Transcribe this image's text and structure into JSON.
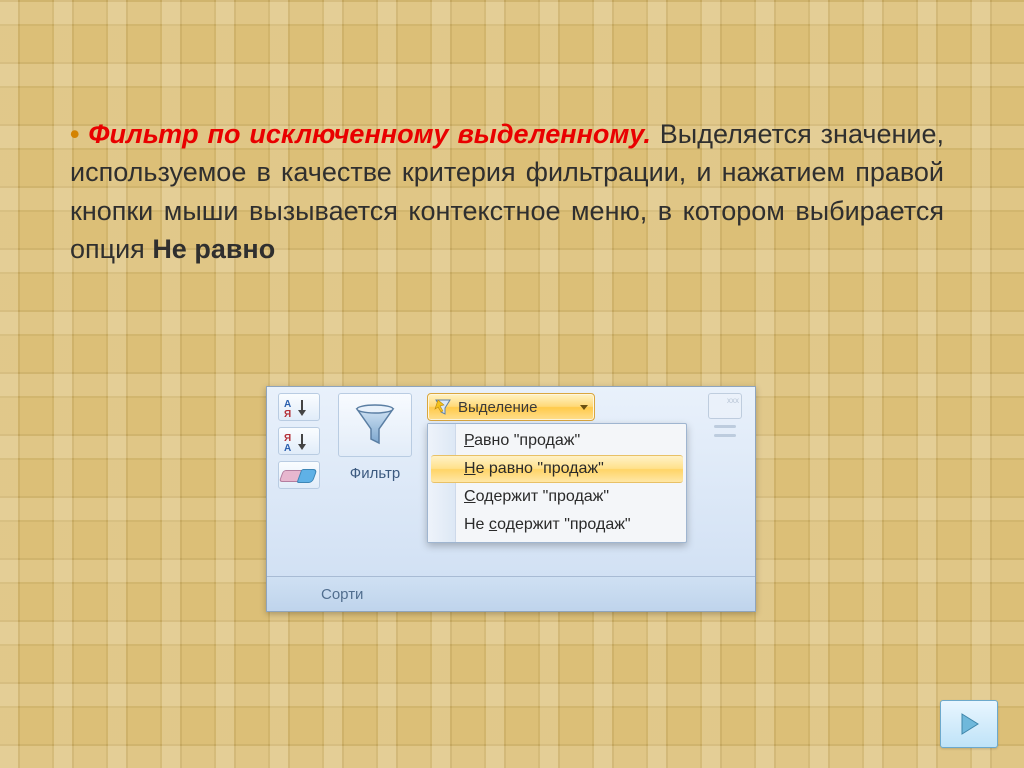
{
  "paragraph": {
    "bullet": "•",
    "title": "Фильтр по исключенному выделенному.",
    "body_a": " Выделяется значение, используемое в качестве критерия фильтрации, и нажатием правой кнопки мыши вызывается контекстное меню, в котором выбирается опция ",
    "strong_option": "Не равно"
  },
  "ribbon": {
    "filter_label": "Фильтр",
    "footer_label": "Сорти",
    "selection_label": "Выделение",
    "menu": {
      "equals": {
        "hot": "Р",
        "rest": "авно \"продаж\""
      },
      "not_equals": {
        "hot": "Н",
        "rest": "е равно \"продаж\""
      },
      "contains": {
        "hot": "С",
        "rest": "одержит \"продаж\""
      },
      "not_contains": {
        "pre": "Не ",
        "hot": "с",
        "rest": "одержит \"продаж\""
      }
    }
  }
}
